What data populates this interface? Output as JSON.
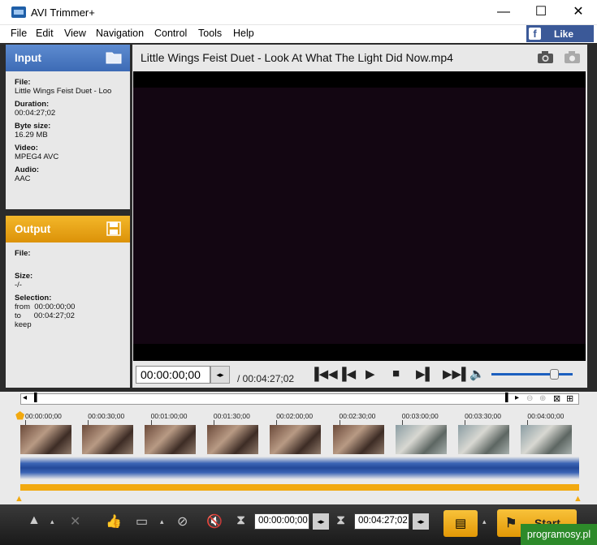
{
  "window": {
    "title": "AVI Trimmer+",
    "minimize": "—",
    "maximize": "☐",
    "close": "✕"
  },
  "menu": [
    "File",
    "Edit",
    "View",
    "Navigation",
    "Control",
    "Tools",
    "Help"
  ],
  "facebook": {
    "label": "Like"
  },
  "input_panel": {
    "title": "Input",
    "file_label": "File:",
    "file_value": "Little Wings   Feist Duet - Loo",
    "duration_label": "Duration:",
    "duration_value": "00:04:27;02",
    "bytes_label": "Byte size:",
    "bytes_value": "16.29 MB",
    "video_label": "Video:",
    "video_value": "MPEG4 AVC",
    "audio_label": "Audio:",
    "audio_value": "AAC"
  },
  "output_panel": {
    "title": "Output",
    "file_label": "File:",
    "size_label": "Size:",
    "size_value": "-/-",
    "selection_label": "Selection:",
    "from_label": "from",
    "from_value": "00:00:00;00",
    "to_label": "to",
    "to_value": "00:04:27;02",
    "mode": "keep"
  },
  "player": {
    "file_name": "Little Wings   Feist Duet - Look At What The Light Did Now.mp4",
    "current_time": "00:00:00;00",
    "total_time": "/ 00:04:27;02",
    "volume": 0.78
  },
  "timeline": {
    "ticks": [
      "00:00:00;00",
      "00:00:30;00",
      "00:01:00;00",
      "00:01:30;00",
      "00:02:00;00",
      "00:02:30;00",
      "00:03:00;00",
      "00:03:30;00",
      "00:04:00;00"
    ]
  },
  "toolbar": {
    "start_time": "00:00:00;00",
    "end_time": "00:04:27;02",
    "start_label": "Start"
  },
  "watermark": "programosy.pl"
}
